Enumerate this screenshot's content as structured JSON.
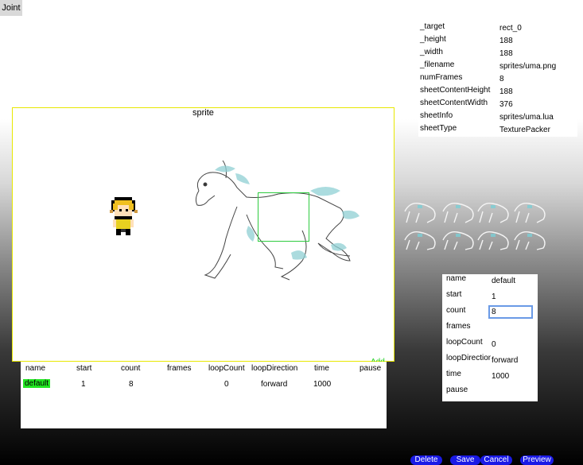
{
  "tab": {
    "label": "Joint"
  },
  "props": [
    {
      "key": "_target",
      "value": "rect_0"
    },
    {
      "key": "_height",
      "value": "188"
    },
    {
      "key": "_width",
      "value": "188"
    },
    {
      "key": "_filename",
      "value": "sprites/uma.png"
    },
    {
      "key": "numFrames",
      "value": "8"
    },
    {
      "key": "sheetContentHeight",
      "value": "188"
    },
    {
      "key": "sheetContentWidth",
      "value": "376"
    },
    {
      "key": "sheetInfo",
      "value": "sprites/uma.lua"
    },
    {
      "key": "sheetType",
      "value": "TexturePacker"
    }
  ],
  "stage": {
    "title": "sprite",
    "label": "sprite",
    "add_label": "Add"
  },
  "table": {
    "columns": [
      "name",
      "start",
      "count",
      "frames",
      "loopCount",
      "loopDirection",
      "time",
      "pause"
    ],
    "rows": [
      {
        "name": "default",
        "start": "1",
        "count": "8",
        "frames": "",
        "loopCount": "0",
        "loopDirection": "forward",
        "time": "1000",
        "pause": ""
      }
    ]
  },
  "editor": {
    "fields": {
      "name": {
        "label": "name",
        "value": "default"
      },
      "start": {
        "label": "start",
        "value": "1"
      },
      "count": {
        "label": "count",
        "value": "8"
      },
      "frames": {
        "label": "frames",
        "value": ""
      },
      "loopCount": {
        "label": "loopCount",
        "value": "0"
      },
      "loopDirection": {
        "label": "loopDirection",
        "value": "forward"
      },
      "time": {
        "label": "time",
        "value": "1000"
      },
      "pause": {
        "label": "pause",
        "value": ""
      }
    }
  },
  "buttons": {
    "delete": "Delete",
    "save": "Save",
    "cancel": "Cancel",
    "preview": "Preview"
  },
  "colors": {
    "accent_blue": "#1a1ae6",
    "selection_green": "#2ecc40",
    "stage_border": "#e8e800"
  }
}
